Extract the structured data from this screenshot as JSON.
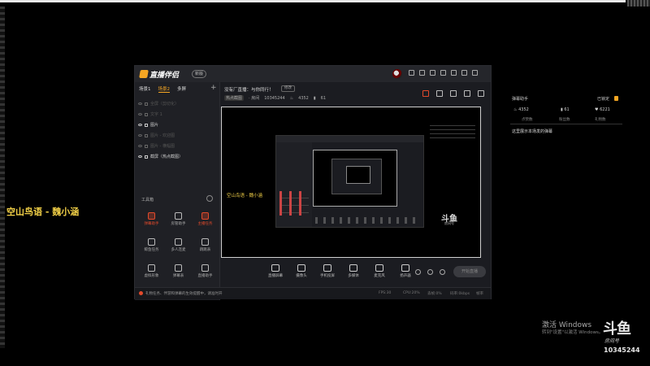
{
  "overlay": {
    "title": "空山鸟语 - 魏小涵"
  },
  "app": {
    "name": "直播伴侣",
    "version": "新版",
    "tabs": [
      "场景1",
      "场景2",
      "多屏"
    ],
    "layers": [
      {
        "label": "全屏（剪切化）",
        "on": false
      },
      {
        "label": "文字 1",
        "on": false
      },
      {
        "label": "图片",
        "on": true
      },
      {
        "label": "图片 - 欢迎图",
        "on": false
      },
      {
        "label": "图片 - 横幅图",
        "on": false
      },
      {
        "label": "截屏（热点截图）",
        "on": true
      }
    ],
    "toolbox_title": "工具箱",
    "tools": [
      {
        "label": "弹幕助手",
        "hot": true
      },
      {
        "label": "房管助手",
        "hot": false
      },
      {
        "label": "主播任务",
        "hot": true
      },
      {
        "label": "鲸鱼任务",
        "hot": false
      },
      {
        "label": "多人连麦",
        "hot": false
      },
      {
        "label": "跳跳表",
        "hot": false
      },
      {
        "label": "虚拟形象",
        "hot": false
      },
      {
        "label": "弹幕表",
        "hot": false
      },
      {
        "label": "直播助手",
        "hot": false
      },
      {
        "label": "",
        "hot": false
      },
      {
        "label": "",
        "hot": false
      },
      {
        "label": "",
        "hot": false
      }
    ],
    "stream": {
      "title": "没有厂直播：与你同行！",
      "edit": "修改",
      "category": "热点截图",
      "room_label": "· 房间",
      "room_id": "10345244",
      "hot": "4352",
      "fans": "61"
    },
    "bottom_tools": [
      "直播屏幕",
      "摄像头",
      "手机投屏",
      "多媒体",
      "麦克风",
      "扬声器"
    ],
    "go_live": "开始直播",
    "status": {
      "message": "礼物任务、伴游和弹幕的生效提醒中，请准时开",
      "stats": [
        "FPS:30",
        "CPU:20%",
        "丢帧:0%",
        "码率:0kbps",
        "内存:4GB",
        "直播:00:00",
        "帧率"
      ]
    },
    "preview": {
      "inner_title": "空山鸟语 - 魏小涵",
      "watermark": "斗鱼",
      "watermark_sub": "房间号"
    }
  },
  "barrage": {
    "header": "弹幕助手",
    "locked": "已锁定",
    "stats": [
      {
        "value": "4352",
        "label": "点赞数"
      },
      {
        "value": "61",
        "label": "粉丝数"
      },
      {
        "value": "6221",
        "label": "礼物数"
      }
    ],
    "tip": "这里展示本场发的弹幕"
  },
  "windows": {
    "line1": "激活 Windows",
    "line2": "转到\"设置\"以激活 Windows。"
  },
  "douyu": {
    "logo": "斗鱼",
    "sub": "房间号",
    "room": "10345244"
  },
  "colors": {
    "accent": "#f5a623",
    "hot": "#e34a2b",
    "overlay_text": "#f2d047"
  }
}
